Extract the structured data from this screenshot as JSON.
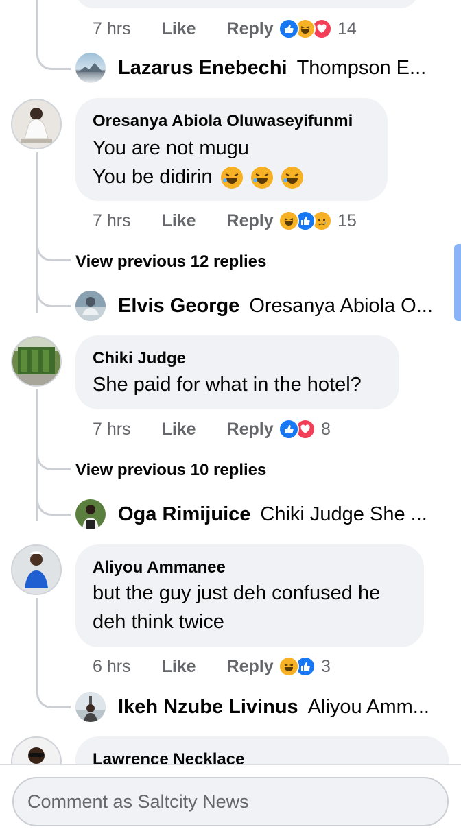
{
  "colors": {
    "like": "#1877f2",
    "love": "#f33e58",
    "haha": "#f7b125",
    "meta_text": "#65676b",
    "bubble": "#f0f2f5"
  },
  "top_meta": {
    "time": "7 hrs",
    "like": "Like",
    "reply": "Reply",
    "reactions": [
      "like-icon",
      "haha-icon",
      "love-icon"
    ],
    "count": "14"
  },
  "top_reply": {
    "name": "Lazarus Enebechi",
    "text": "Thompson E..."
  },
  "comments": [
    {
      "author": "Oresanya Abiola Oluwaseyifunmi",
      "lines": [
        "You are not mugu",
        "You be didirin"
      ],
      "emojis": [
        "rolling-laughing-emoji",
        "rolling-laughing-emoji",
        "rolling-laughing-emoji"
      ],
      "time": "7 hrs",
      "like": "Like",
      "reply": "Reply",
      "reactions": [
        "haha-icon",
        "like-icon",
        "sad-icon"
      ],
      "count": "15",
      "view_previous": "View previous 12 replies",
      "last_reply": {
        "name": "Elvis George",
        "text": "Oresanya Abiola O..."
      }
    },
    {
      "author": "Chiki Judge",
      "lines": [
        "She paid for what in the hotel?"
      ],
      "time": "7 hrs",
      "like": "Like",
      "reply": "Reply",
      "reactions": [
        "like-icon",
        "love-icon"
      ],
      "count": "8",
      "view_previous": "View previous 10 replies",
      "last_reply": {
        "name": "Oga Rimijuice",
        "text": "Chiki Judge She ..."
      }
    },
    {
      "author": "Aliyou Ammanee",
      "lines": [
        "but the guy just deh confused he",
        "deh think twice"
      ],
      "time": "6 hrs",
      "like": "Like",
      "reply": "Reply",
      "reactions": [
        "haha-icon",
        "like-icon"
      ],
      "count": "3",
      "last_reply": {
        "name": "Ikeh Nzube Livinus",
        "text": "Aliyou Amm..."
      }
    },
    {
      "author": "Lawrence Necklace"
    }
  ],
  "composer": {
    "placeholder": "Comment as Saltcity News"
  }
}
